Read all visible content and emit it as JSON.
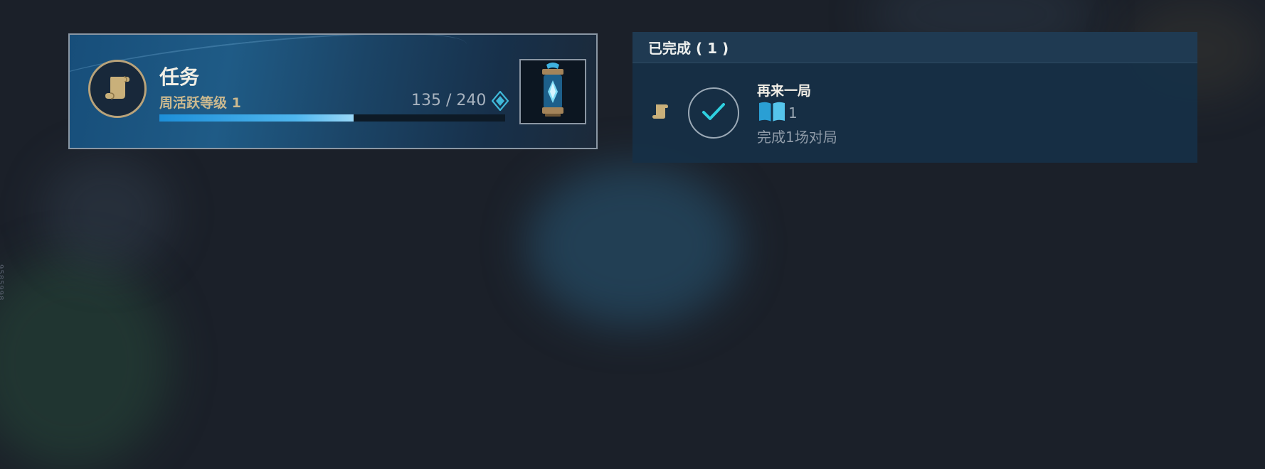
{
  "quest": {
    "title": "任务",
    "subtitle": "周活跃等级 1",
    "progress_text": "135 / 240",
    "progress_current": 135,
    "progress_max": 240,
    "icon": "scroll-icon",
    "reward_icon": "crystal-capsule-icon",
    "currency_icon": "diamond-token-icon"
  },
  "completed": {
    "header": "已完成 ( 1 )",
    "tasks": [
      {
        "title": "再来一局",
        "reward_icon": "book-icon",
        "reward_count": "1",
        "description": "完成1场对局",
        "status_icon": "checkmark-icon",
        "type_icon": "scroll-icon"
      }
    ]
  },
  "side_code": "9585998",
  "colors": {
    "accent_blue": "#3aa9e6",
    "gold": "#cbb98f",
    "check_cyan": "#2fd0e0"
  }
}
